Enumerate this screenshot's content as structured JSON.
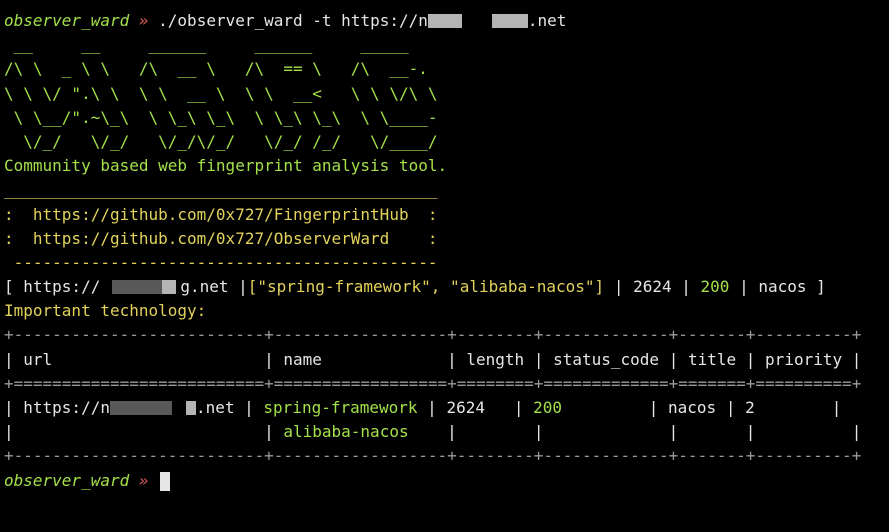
{
  "prompt": {
    "label": "observer_ward",
    "arrow": "»"
  },
  "command": {
    "prefix": "./observer_ward -t https://n",
    "suffix": ".net"
  },
  "banner_lines": [
    " __     __     ______     ______     _____",
    "/\\ \\  _ \\ \\   /\\  __ \\   /\\  == \\   /\\  __-.",
    "\\ \\ \\/ \".\\ \\  \\ \\  __ \\  \\ \\  __<   \\ \\ \\/\\ \\",
    " \\ \\__/\".~\\_\\  \\ \\_\\ \\_\\  \\ \\_\\ \\_\\  \\ \\____-",
    "  \\/_/   \\/_/   \\/_/\\/_/   \\/_/ /_/   \\/____/"
  ],
  "tagline": "Community based web fingerprint analysis tool.",
  "links_box": {
    "top": "_____________________________________________",
    "line1": ":  https://github.com/0x727/FingerprintHub  :",
    "line2": ":  https://github.com/0x727/ObserverWard    :",
    "bottom": " --------------------------------------------"
  },
  "result": {
    "open": "[ ",
    "url_prefix": "https://",
    "url_suffix": "g.net",
    "sep1": " |",
    "names": "[\"spring-framework\", \"alibaba-nacos\"]",
    "sep2": " | ",
    "length": "2624",
    "sep3": " | ",
    "status": "200",
    "sep4": " | ",
    "title": "nacos",
    "close": " ]"
  },
  "important_label": "Important technology:",
  "table": {
    "border_top": "+--------------------------+------------------+--------+-------------+-------+----------+",
    "border_head": "+==========================+==================+========+=============+=======+==========+",
    "headers": [
      "url",
      "name",
      "length",
      "status_code",
      "title",
      "priority"
    ],
    "row": {
      "url_prefix": "https://n",
      "url_suffix": ".net",
      "name1": "spring-framework",
      "name2": "alibaba-nacos",
      "length": "2624",
      "status_code": "200",
      "title": "nacos",
      "priority": "2"
    },
    "border_bottom": "+--------------------------+------------------+--------+-------------+-------+----------+"
  }
}
